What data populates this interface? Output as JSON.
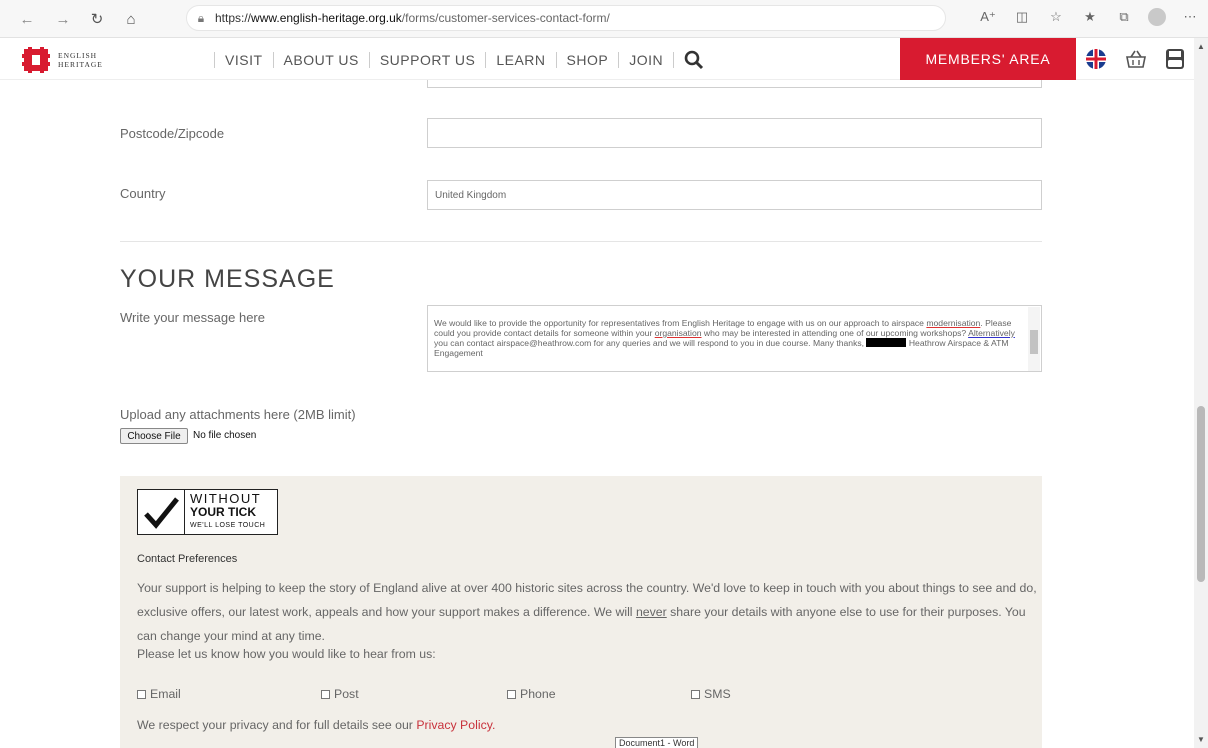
{
  "browser": {
    "url_prefix": "https://",
    "url_host": "www.english-heritage.org.uk",
    "url_path": "/forms/customer-services-contact-form/"
  },
  "site": {
    "logo_line1": "ENGLISH",
    "logo_line2": "HERITAGE",
    "nav": [
      "VISIT",
      "ABOUT US",
      "SUPPORT US",
      "LEARN",
      "SHOP",
      "JOIN"
    ],
    "members_label": "MEMBERS' AREA",
    "brand_color": "#d81b30"
  },
  "form": {
    "postcode_label": "Postcode/Zipcode",
    "postcode_value": "",
    "country_label": "Country",
    "country_value": "United Kingdom",
    "section_title": "YOUR MESSAGE",
    "message_label": "Write your message here",
    "message": {
      "p1": "We would like to provide the opportunity for representatives from English Heritage to engage with us on our approach to airspace ",
      "w1": "modernisation",
      "p2": ". Please could you provide contact details for someone within your ",
      "w2": "organisation",
      "p3": " who may be interested in attending one of our upcoming workshops? ",
      "w3": "Alternatively",
      "p4": " you can contact airspace@heathrow.com for any queries and we will respond to you in due course. Many thanks, ",
      "p5": " Heathrow Airspace & ATM Engagement"
    },
    "upload_label": "Upload any attachments here (2MB limit)",
    "choose_file": "Choose File",
    "no_file": "No file chosen"
  },
  "preferences": {
    "badge_line1": "WITHOUT",
    "badge_line2": "YOUR TICK",
    "badge_line3": "WE'LL LOSE TOUCH",
    "heading": "Contact Preferences",
    "text_a": "Your support is helping to keep the story of England alive at over 400 historic sites across the country. We'd love to keep in touch with you about things to see and do, exclusive offers, our latest work, appeals and how your support makes a difference. We will ",
    "text_never": "never",
    "text_b": " share your details with anyone else to use for their purposes. You can change your mind at any time.",
    "ask": "Please let us know how you would like to hear from us:",
    "options": [
      "Email",
      "Post",
      "Phone",
      "SMS"
    ],
    "privacy_text": "We respect your privacy and for full details see our ",
    "privacy_link": "Privacy Policy.",
    "panel_color": "#f2efe9"
  },
  "taskbar_tooltip": "Document1 - Word"
}
